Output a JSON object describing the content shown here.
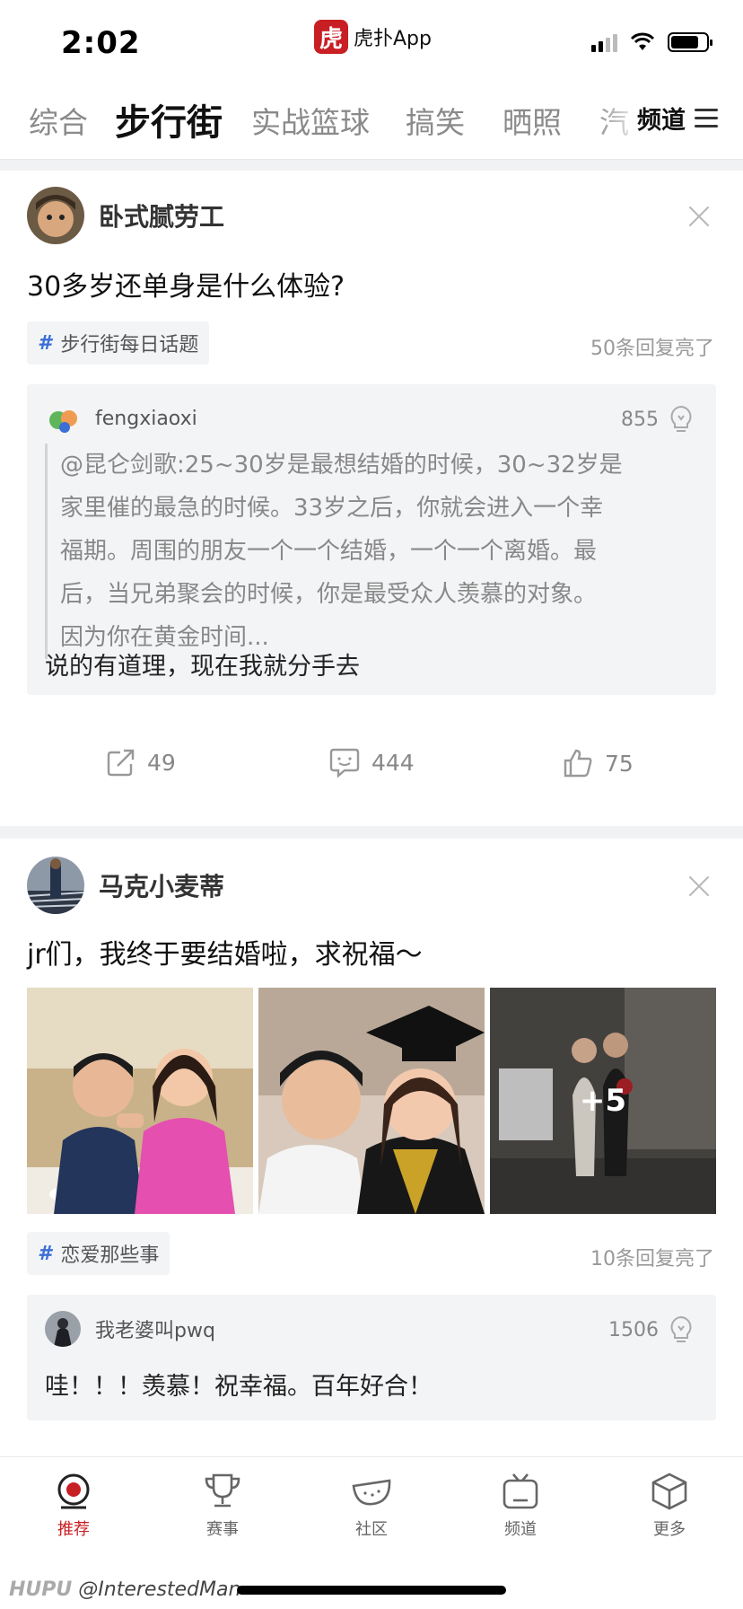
{
  "status": {
    "time": "2:02",
    "app_name": "虎扑App",
    "app_logo_char": "虎"
  },
  "tabs": {
    "items": [
      "综合",
      "步行街",
      "实战篮球",
      "搞笑",
      "晒照",
      "汽"
    ],
    "active": "步行街",
    "channel_label": "频道"
  },
  "posts": [
    {
      "author": "卧式腻劳工",
      "title": "30多岁还单身是什么体验?",
      "topic": "步行街每日话题",
      "reply_count": "50条回复亮了",
      "comment": {
        "user": "fengxiaoxi",
        "lights": "855",
        "quote_lines": [
          "@昆仑剑歌:25~30岁是最想结婚的时候，30~32岁是",
          "家里催的最急的时候。33岁之后，你就会进入一个幸",
          "福期。周围的朋友一个一个结婚，一个一个离婚。最",
          "后，当兄弟聚会的时候，你是最受众人羡慕的对象。",
          "因为你在黄金时间..."
        ],
        "text": "说的有道理，现在我就分手去"
      },
      "actions": {
        "share": "49",
        "comments": "444",
        "likes": "75"
      }
    },
    {
      "author": "马克小麦蒂",
      "title": "jr们，我终于要结婚啦，求祝福～",
      "more_images": "+5",
      "topic": "恋爱那些事",
      "reply_count": "10条回复亮了",
      "comment": {
        "user": "我老婆叫pwq",
        "lights": "1506",
        "text": "哇！！！羡慕！祝幸福。百年好合！"
      }
    }
  ],
  "bottom_nav": [
    {
      "label": "推荐",
      "icon": "recommend-icon",
      "active": true
    },
    {
      "label": "赛事",
      "icon": "trophy-icon",
      "active": false
    },
    {
      "label": "社区",
      "icon": "community-icon",
      "active": false
    },
    {
      "label": "频道",
      "icon": "tv-icon",
      "active": false
    },
    {
      "label": "更多",
      "icon": "cube-icon",
      "active": false
    }
  ],
  "watermark": {
    "brand": "HUPU",
    "handle": "@InterestedMan"
  },
  "colors": {
    "accent": "#c81f24",
    "topic_icon": "#3b6fd6",
    "comment_bg": "#f3f4f6"
  }
}
